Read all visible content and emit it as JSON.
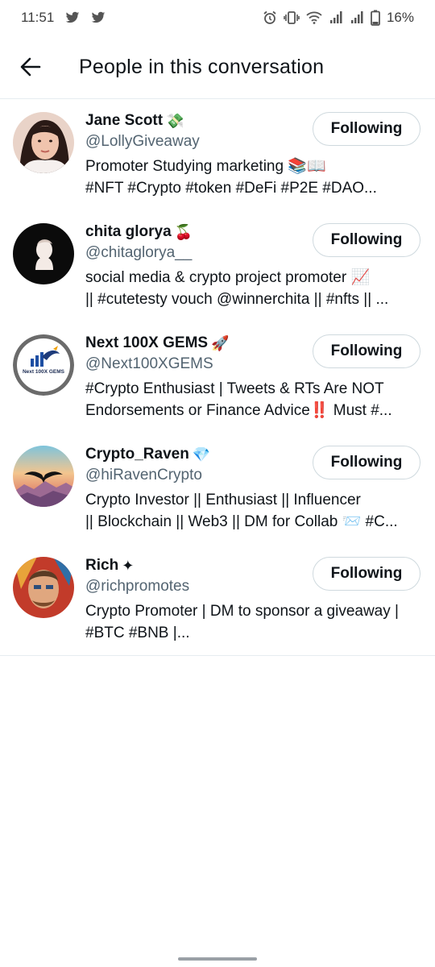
{
  "status_bar": {
    "time": "11:51",
    "battery": "16%",
    "icons": [
      "twitter-bird-icon",
      "twitter-bird-icon",
      "alarm-icon",
      "vibrate-icon",
      "wifi-icon",
      "signal-icon",
      "signal-icon",
      "battery-icon"
    ]
  },
  "header": {
    "back_icon": "arrow-left-icon",
    "title": "People in this conversation"
  },
  "people": [
    {
      "name": "Jane Scott",
      "name_emoji": "💸",
      "handle": "@LollyGiveaway",
      "bio_line1": "Promoter Studying marketing 📚📖",
      "bio_line2": "#NFT #Crypto #token #DeFi #P2E #DAO...",
      "button": "Following"
    },
    {
      "name": "chita glorya",
      "name_emoji": "🍒",
      "handle": "@chitaglorya__",
      "bio_line1": "social media & crypto project promoter 📈",
      "bio_line2": "|| #cutetesty vouch @winnerchita || #nfts || ...",
      "button": "Following"
    },
    {
      "name": "Next 100X GEMS",
      "name_emoji": "🚀",
      "handle": "@Next100XGEMS",
      "bio_line1": "#Crypto Enthusiast | Tweets & RTs Are NOT",
      "bio_line2": "Endorsements or Finance Advice‼️ Must #...",
      "button": "Following",
      "avatar_text": "Next 100X GEMS"
    },
    {
      "name": "Crypto_Raven",
      "name_emoji": "💎",
      "handle": "@hiRavenCrypto",
      "bio_line1": "Crypto Investor || Enthusiast || Influencer",
      "bio_line2": "|| Blockchain || Web3 || DM for Collab 📨 #C...",
      "button": "Following"
    },
    {
      "name": "Rich",
      "name_emoji": "✦",
      "handle": "@richpromotes",
      "bio_line1": "Crypto Promoter | DM to sponsor a giveaway |",
      "bio_line2": "#BTC #BNB |...",
      "button": "Following"
    }
  ]
}
